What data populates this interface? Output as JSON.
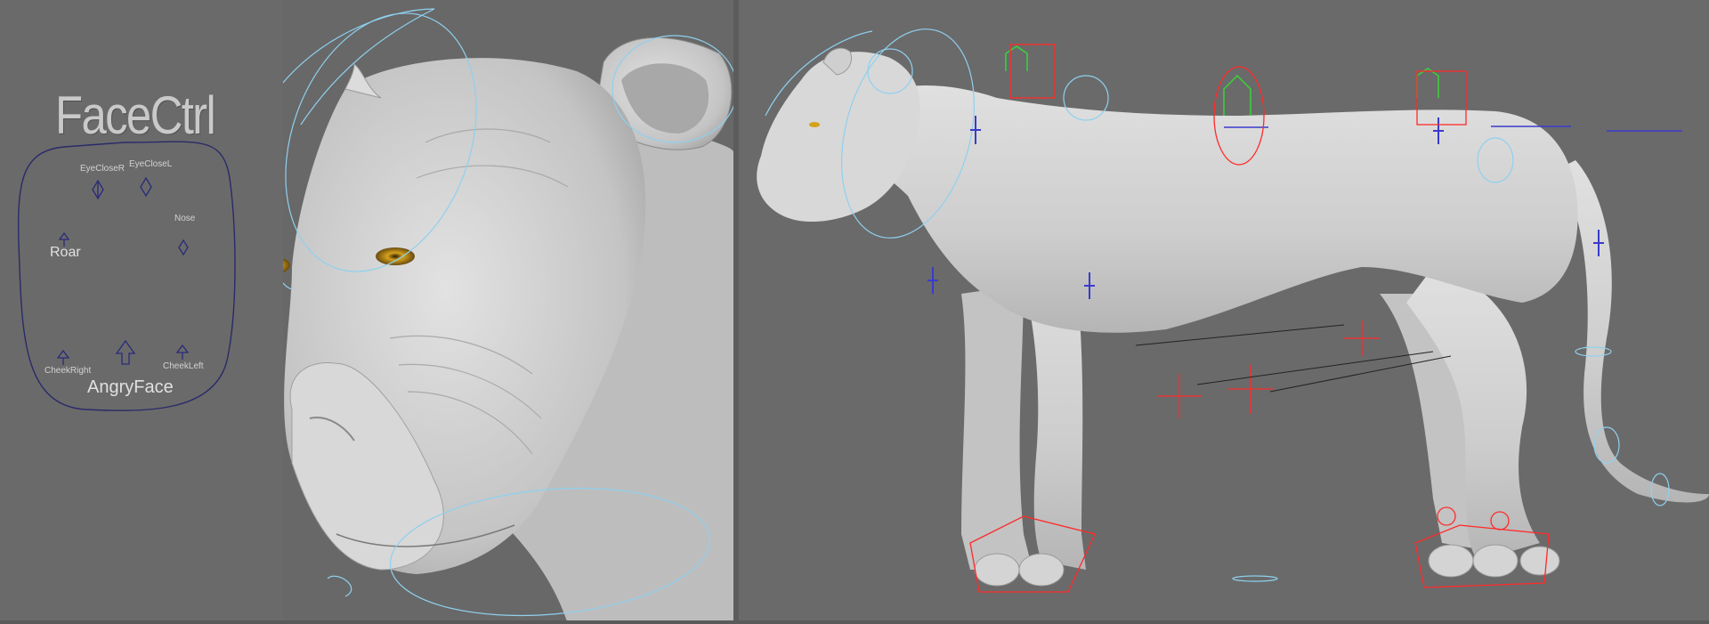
{
  "face_ctrl": {
    "title": "FaceCtrl",
    "labels": {
      "eye_close_r": "EyeCloseR",
      "eye_close_l": "EyeCloseL",
      "nose": "Nose",
      "roar": "Roar",
      "cheek_right": "CheekRight",
      "cheek_left": "CheekLeft",
      "angry_face": "AngryFace"
    }
  },
  "colors": {
    "viewport_bg": "#6a6a6a",
    "mesh": "#d4d4d4",
    "nurbs_curve": "#8fd0ef",
    "ik_handle": "#ff2a2a",
    "locator": "#3a3acc",
    "spine_ctrl": "#3ad33a",
    "eye": "#d4a21a"
  }
}
